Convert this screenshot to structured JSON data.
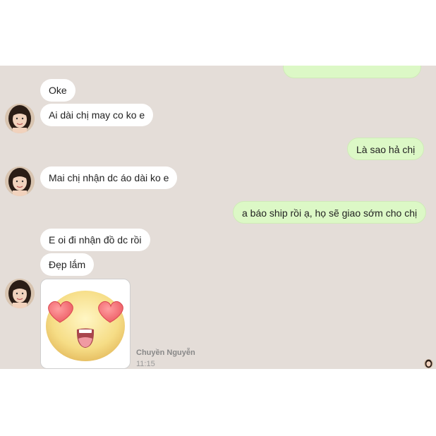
{
  "messages": {
    "incoming": [
      "Oke",
      "Ai dài chị may co ko e",
      "Mai chị nhận dc áo dài ko e",
      "E oi đi nhận đồ dc rồi",
      "Đẹp lắm"
    ],
    "outgoing": [
      "Là sao hả chị",
      "a báo ship rồi ạ, họ sẽ giao sớm cho chị"
    ]
  },
  "sticker": {
    "name": "heart-eyes-emoji-sticker"
  },
  "meta": {
    "sender": "Chuyền Nguyễn",
    "time": "11:15"
  },
  "colors": {
    "chat_bg": "#e4ddd8",
    "incoming_bg": "#ffffff",
    "outgoing_bg": "#dcf8c6"
  }
}
